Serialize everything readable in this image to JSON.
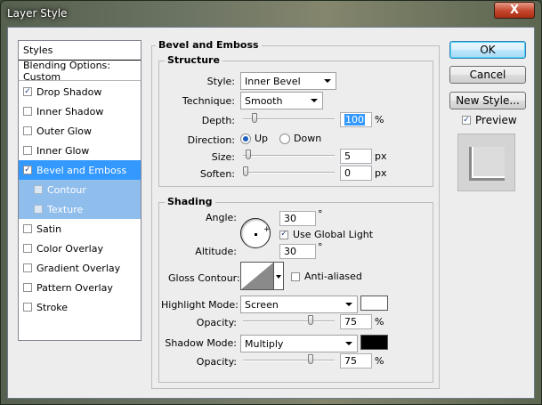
{
  "window": {
    "title": "Layer Style",
    "close_glyph": "X"
  },
  "left_panel": {
    "items": [
      {
        "label": "Styles",
        "checked": null
      },
      {
        "label": "Blending Options: Custom",
        "checked": null
      },
      {
        "label": "Drop Shadow",
        "checked": true
      },
      {
        "label": "Inner Shadow",
        "checked": false
      },
      {
        "label": "Outer Glow",
        "checked": false
      },
      {
        "label": "Inner Glow",
        "checked": false
      },
      {
        "label": "Bevel and Emboss",
        "checked": true,
        "selected": true
      },
      {
        "label": "Contour",
        "checked": false,
        "sub": true
      },
      {
        "label": "Texture",
        "checked": false,
        "sub": true
      },
      {
        "label": "Satin",
        "checked": false
      },
      {
        "label": "Color Overlay",
        "checked": false
      },
      {
        "label": "Gradient Overlay",
        "checked": false
      },
      {
        "label": "Pattern Overlay",
        "checked": false
      },
      {
        "label": "Stroke",
        "checked": false
      }
    ]
  },
  "buttons": {
    "ok": "OK",
    "cancel": "Cancel",
    "new_style": "New Style...",
    "preview": "Preview",
    "preview_checked": true
  },
  "bevel": {
    "title": "Bevel and Emboss",
    "structure": {
      "title": "Structure",
      "style_label": "Style:",
      "style_value": "Inner Bevel",
      "technique_label": "Technique:",
      "technique_value": "Smooth",
      "depth_label": "Depth:",
      "depth_value": "100",
      "depth_unit": "%",
      "depth_slider": 0.1,
      "direction_label": "Direction:",
      "direction_up": "Up",
      "direction_down": "Down",
      "direction_selected": "Up",
      "size_label": "Size:",
      "size_value": "5",
      "size_unit": "px",
      "size_slider": 0.03,
      "soften_label": "Soften:",
      "soften_value": "0",
      "soften_unit": "px",
      "soften_slider": 0.0
    },
    "shading": {
      "title": "Shading",
      "angle_label": "Angle:",
      "angle_value": "30",
      "angle_unit": "°",
      "global_light_label": "Use Global Light",
      "global_light_checked": true,
      "altitude_label": "Altitude:",
      "altitude_value": "30",
      "altitude_unit": "°",
      "gloss_label": "Gloss Contour:",
      "anti_aliased_label": "Anti-aliased",
      "anti_aliased_checked": false,
      "highlight_mode_label": "Highlight Mode:",
      "highlight_mode_value": "Screen",
      "highlight_color": "#ffffff",
      "highlight_opacity_label": "Opacity:",
      "highlight_opacity_value": "75",
      "highlight_opacity_unit": "%",
      "highlight_opacity_slider": 0.75,
      "shadow_mode_label": "Shadow Mode:",
      "shadow_mode_value": "Multiply",
      "shadow_color": "#000000",
      "shadow_opacity_label": "Opacity:",
      "shadow_opacity_value": "75",
      "shadow_opacity_unit": "%",
      "shadow_opacity_slider": 0.75
    }
  }
}
